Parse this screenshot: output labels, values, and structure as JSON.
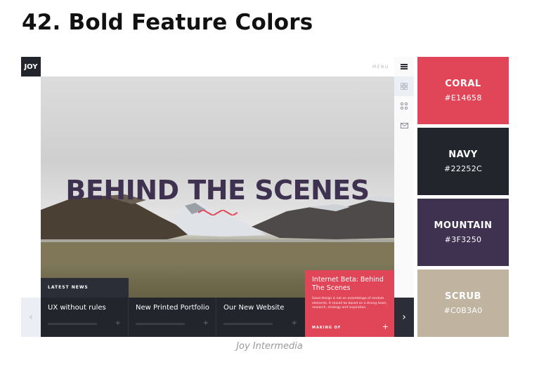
{
  "article": {
    "heading": "42. Bold Feature Colors",
    "caption": "Joy Intermedia"
  },
  "website": {
    "logo": "JOY",
    "menu_label": "MENU",
    "rail_icons": [
      "menu-icon",
      "grid-icon",
      "apps-icon",
      "mail-icon"
    ],
    "hero_title": "BEHIND THE SCENES",
    "latest_news_label": "LATEST NEWS",
    "news_items": [
      {
        "title": "UX without rules"
      },
      {
        "title": "New Printed Portfolio"
      },
      {
        "title": "Our New Website"
      }
    ],
    "feature": {
      "title": "Internet Beta: Behind The Scenes",
      "body": "Good design is not an assemblage of random elements. It should be based on a strong team, research, strategy and inspiration.",
      "meta": "MAKING OF",
      "plus": "+"
    },
    "arrows": {
      "left": "‹",
      "right": "›"
    }
  },
  "palette": [
    {
      "name": "CORAL",
      "hex": "#E14658",
      "color": "#e14658"
    },
    {
      "name": "NAVY",
      "hex": "#22252C",
      "color": "#22252c"
    },
    {
      "name": "MOUNTAIN",
      "hex": "#3F3250",
      "color": "#3f3250"
    },
    {
      "name": "SCRUB",
      "hex": "#C0B3A0",
      "color": "#c0b3a0"
    }
  ]
}
